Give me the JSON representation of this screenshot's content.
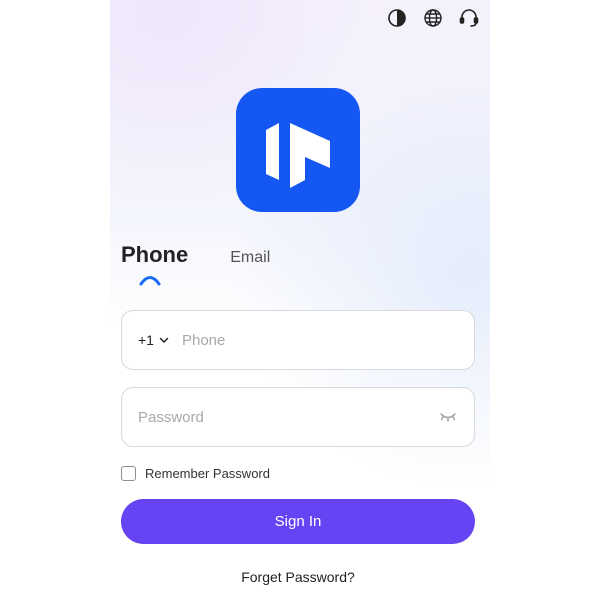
{
  "toolbar": {
    "icons": [
      "contrast-icon",
      "globe-icon",
      "headset-icon"
    ]
  },
  "brand": {
    "logo_color": "#1557f2"
  },
  "tabs": [
    {
      "label": "Phone",
      "active": true
    },
    {
      "label": "Email",
      "active": false
    }
  ],
  "phone_field": {
    "country_code": "+1",
    "placeholder": "Phone",
    "value": ""
  },
  "password_field": {
    "placeholder": "Password",
    "value": ""
  },
  "remember": {
    "label": "Remember Password",
    "checked": false
  },
  "sign_in": {
    "label": "Sign In",
    "color": "#6644f4"
  },
  "forgot": {
    "label": "Forget Password?"
  }
}
